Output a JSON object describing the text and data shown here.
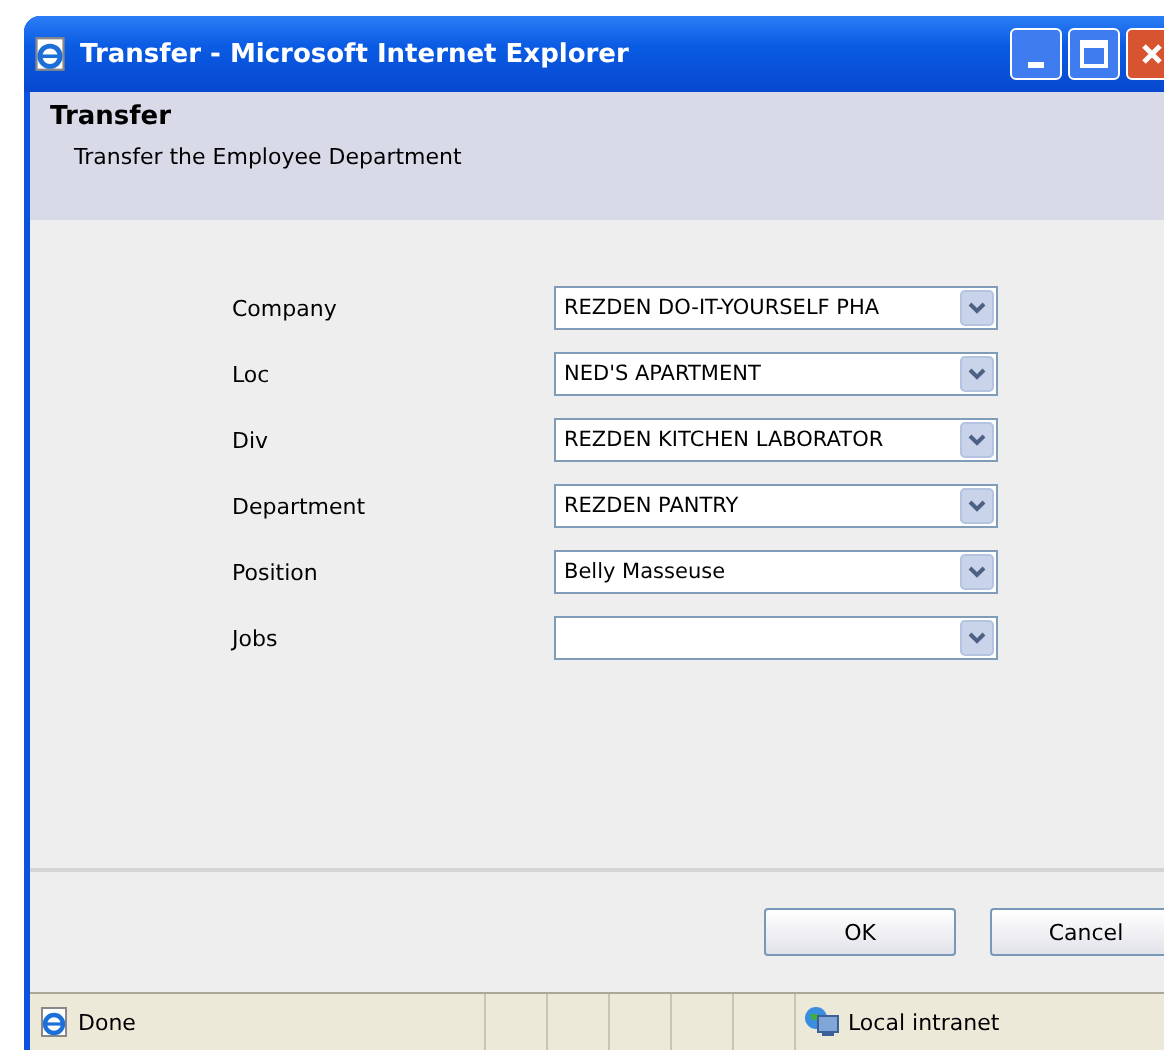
{
  "window": {
    "title": "Transfer - Microsoft Internet Explorer"
  },
  "header": {
    "title": "Transfer",
    "subtitle": "Transfer the Employee Department"
  },
  "fields": [
    {
      "label": "Company",
      "value": "REZDEN DO-IT-YOURSELF PHA"
    },
    {
      "label": "Loc",
      "value": "NED'S APARTMENT"
    },
    {
      "label": "Div",
      "value": "REZDEN KITCHEN LABORATOR"
    },
    {
      "label": "Department",
      "value": "REZDEN PANTRY"
    },
    {
      "label": "Position",
      "value": "Belly Masseuse"
    },
    {
      "label": "Jobs"
    }
  ],
  "buttons": [
    "OK",
    "Cancel"
  ],
  "status_bar": {
    "status": "Done",
    "zone": "Local intranet"
  }
}
